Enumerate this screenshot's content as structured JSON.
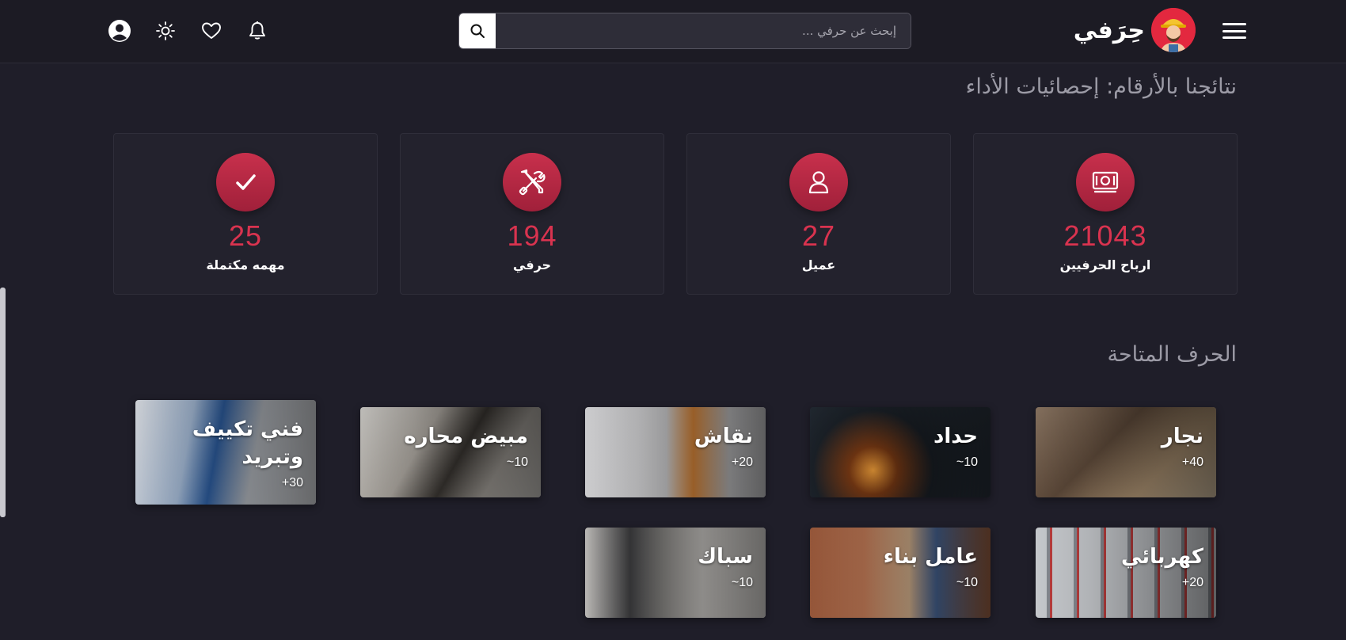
{
  "header": {
    "brand_name": "حِرَفي",
    "search_placeholder": "إبحث عن حرفي ..."
  },
  "stats_section": {
    "title": "نتائجنا بالأرقام: إحصائيات الأداء",
    "items": [
      {
        "value": "21043",
        "label": "ارباح الحرفيين",
        "icon": "money-icon"
      },
      {
        "value": "27",
        "label": "عميل",
        "icon": "user-icon"
      },
      {
        "value": "194",
        "label": "حرفي",
        "icon": "tools-icon"
      },
      {
        "value": "25",
        "label": "مهمه مكتملة",
        "icon": "check-icon"
      }
    ]
  },
  "crafts_section": {
    "title": "الحرف المتاحة",
    "items": [
      {
        "name": "نجار",
        "count": "40+"
      },
      {
        "name": "حداد",
        "count": "10~"
      },
      {
        "name": "نقاش",
        "count": "20+"
      },
      {
        "name": "مبيض محاره",
        "count": "10~"
      },
      {
        "name": "فني تكييف وتبريد",
        "count": "30+"
      },
      {
        "name": "كهربائي",
        "count": "20+"
      },
      {
        "name": "عامل بناء",
        "count": "10~"
      },
      {
        "name": "سباك",
        "count": "10~"
      }
    ]
  },
  "colors": {
    "background": "#1f1e29",
    "accent": "#d9334f",
    "card": "#23222d"
  }
}
